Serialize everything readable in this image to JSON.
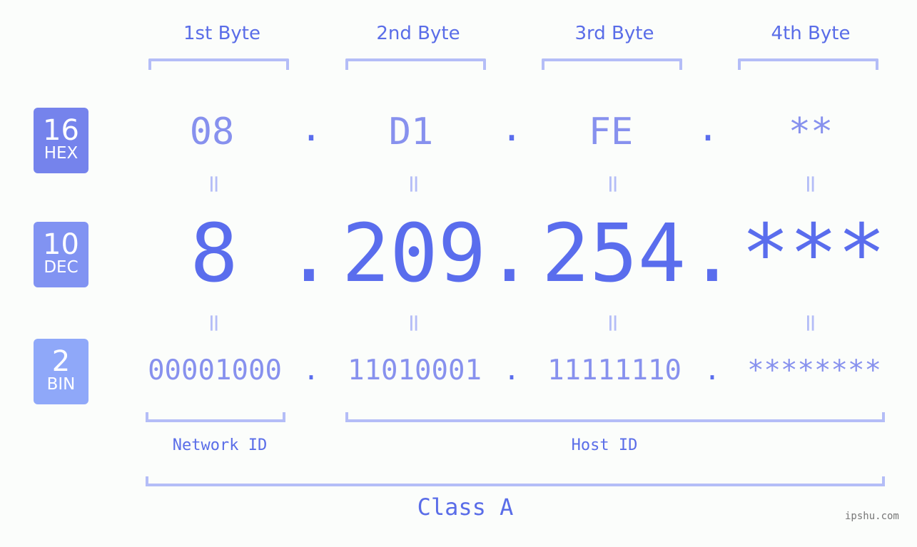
{
  "byte_headers": [
    "1st Byte",
    "2nd Byte",
    "3rd Byte",
    "4th Byte"
  ],
  "rows": {
    "hex": {
      "base": "16",
      "label": "HEX",
      "values": [
        "08",
        "D1",
        "FE",
        "**"
      ],
      "color": "#7583ec"
    },
    "dec": {
      "base": "10",
      "label": "DEC",
      "values": [
        "8",
        "209",
        "254",
        "***"
      ],
      "color": "#8193f2"
    },
    "bin": {
      "base": "2",
      "label": "BIN",
      "values": [
        "00001000",
        "11010001",
        "11111110",
        "********"
      ],
      "color": "#8fa8f9"
    }
  },
  "separator": ".",
  "equals": "=",
  "network_id_label": "Network ID",
  "host_id_label": "Host ID",
  "class_label": "Class A",
  "watermark": "ipshu.com",
  "colors": {
    "accent": "#5a6ded",
    "light_value": "#8791ee",
    "bracket": "#b4bdf7"
  }
}
